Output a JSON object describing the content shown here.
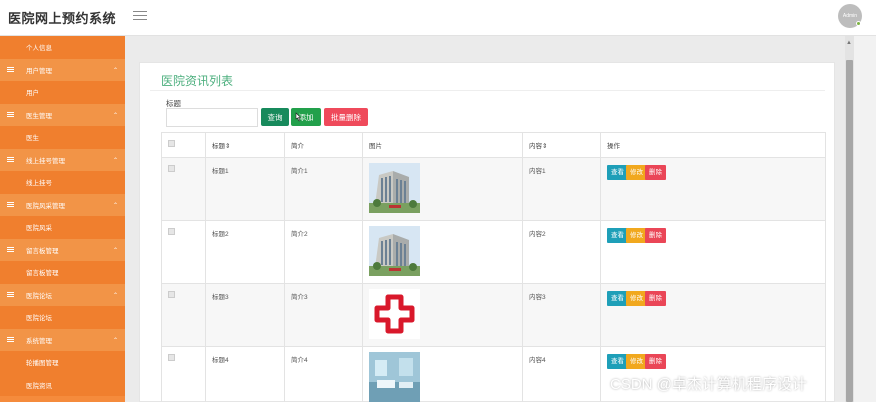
{
  "app": {
    "title": "医院网上预约系统",
    "avatar_text": "Admin"
  },
  "sidebar": {
    "items": [
      {
        "type": "leaf",
        "label": "个人信息"
      },
      {
        "type": "group",
        "label": "用户管理"
      },
      {
        "type": "leaf",
        "label": "用户"
      },
      {
        "type": "group",
        "label": "医生管理"
      },
      {
        "type": "leaf",
        "label": "医生"
      },
      {
        "type": "group",
        "label": "线上挂号管理"
      },
      {
        "type": "leaf",
        "label": "线上挂号"
      },
      {
        "type": "group",
        "label": "医院风采管理"
      },
      {
        "type": "leaf",
        "label": "医院风采"
      },
      {
        "type": "group",
        "label": "留言板管理"
      },
      {
        "type": "leaf",
        "label": "留言板管理"
      },
      {
        "type": "group",
        "label": "医院论坛"
      },
      {
        "type": "leaf",
        "label": "医院论坛"
      },
      {
        "type": "group",
        "label": "系统管理"
      },
      {
        "type": "leaf",
        "label": "轮播图管理"
      },
      {
        "type": "leaf",
        "label": "医院资讯"
      }
    ]
  },
  "page": {
    "title": "医院资讯列表",
    "search": {
      "label": "标题",
      "value": "",
      "placeholder": ""
    },
    "buttons": {
      "search": "查询",
      "add": "添加",
      "batch_delete": "批量删除"
    }
  },
  "table": {
    "headers": [
      "标题",
      "简介",
      "图片",
      "内容",
      "操作"
    ],
    "sort_mark": "⇕",
    "rows": [
      {
        "title": "标题1",
        "intro": "简介1",
        "image": "hospital-building",
        "content": "内容1"
      },
      {
        "title": "标题2",
        "intro": "简介2",
        "image": "hospital-building",
        "content": "内容2"
      },
      {
        "title": "标题3",
        "intro": "简介3",
        "image": "red-cross",
        "content": "内容3"
      },
      {
        "title": "标题4",
        "intro": "简介4",
        "image": "ward-room",
        "content": "内容4"
      }
    ],
    "actions": {
      "view": "查看",
      "edit": "修改",
      "delete": "删除"
    }
  },
  "watermark": "CSDN @卓杰计算机程序设计",
  "colors": {
    "sidebar": "#f58b3c",
    "title_green": "#4caf7e",
    "view": "#1e9fb8",
    "edit": "#f1a81e",
    "delete": "#ea4657"
  }
}
